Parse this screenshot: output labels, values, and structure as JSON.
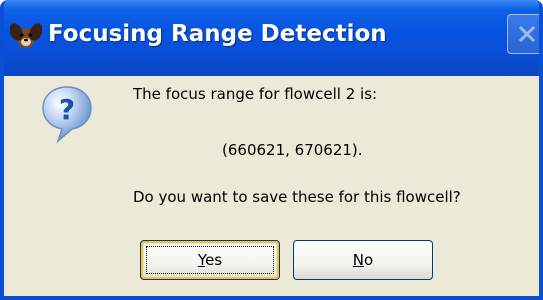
{
  "window": {
    "title": "Focusing Range Detection",
    "app_icon": "dog-app-icon",
    "close_icon": "close-icon"
  },
  "dialog": {
    "icon": "question-icon",
    "message_line1": "The focus range for flowcell 2 is:",
    "message_line2": "(660621, 670621).",
    "message_line3": "Do you want to save these for this flowcell?"
  },
  "buttons": {
    "yes": {
      "mnemonic": "Y",
      "rest": "es"
    },
    "no": {
      "mnemonic": "N",
      "rest": "o"
    }
  },
  "colors": {
    "titlebar": "#0a4fd6",
    "dialog_bg": "#ece9d8",
    "focus_glow": "#f0c050"
  }
}
